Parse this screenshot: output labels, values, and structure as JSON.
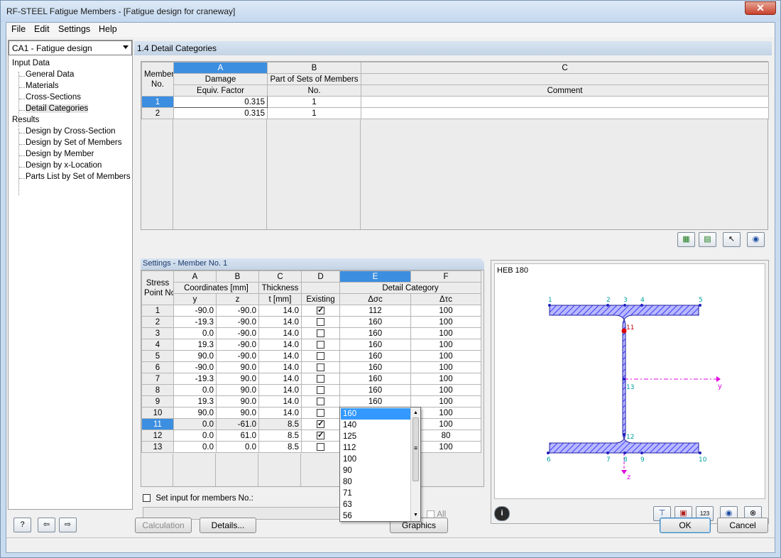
{
  "window": {
    "title": "RF-STEEL Fatigue Members - [Fatigue design for craneway]",
    "close": "✕"
  },
  "menu": {
    "file": "File",
    "edit": "Edit",
    "settings": "Settings",
    "help": "Help"
  },
  "case_combo": {
    "value": "CA1 - Fatigue design"
  },
  "nav": {
    "input_data": "Input Data",
    "general_data": "General Data",
    "materials": "Materials",
    "cross_sections": "Cross-Sections",
    "detail_categories": "Detail Categories",
    "results": "Results",
    "design_by_cross_section": "Design by Cross-Section",
    "design_by_set_of_members": "Design by Set of Members",
    "design_by_member": "Design by Member",
    "design_by_x_location": "Design by x-Location",
    "parts_list": "Parts List by Set of Members"
  },
  "top_panel": {
    "title": "1.4 Detail Categories",
    "col_letters": [
      "A",
      "B",
      "C"
    ],
    "h_member_1": "Member",
    "h_member_2": "No.",
    "h_a1": "Damage",
    "h_a2": "Equiv. Factor",
    "h_b1": "Part of Sets of Members",
    "h_b2": "No.",
    "h_c2": "Comment",
    "rows": [
      {
        "no": "1",
        "factor": "0.315",
        "set": "1",
        "comment": ""
      },
      {
        "no": "2",
        "factor": "0.315",
        "set": "1",
        "comment": ""
      }
    ]
  },
  "settings_panel": {
    "title": "Settings - Member No. 1",
    "col_letters": [
      "A",
      "B",
      "C",
      "D",
      "E",
      "F"
    ],
    "h_stress": "Stress",
    "h_point": "Point No.",
    "h_coords": "Coordinates [mm]",
    "h_y": "y",
    "h_z": "z",
    "h_thick": "Thickness",
    "h_t": "t [mm]",
    "h_existing": "Existing",
    "h_detail": "Detail Category",
    "h_dsigma": "Δσc",
    "h_dtau": "Δτc",
    "rows": [
      {
        "no": "1",
        "y": "-90.0",
        "z": "-90.0",
        "t": "14.0",
        "existing": true,
        "ds": "112",
        "dt": "100"
      },
      {
        "no": "2",
        "y": "-19.3",
        "z": "-90.0",
        "t": "14.0",
        "existing": false,
        "ds": "160",
        "dt": "100"
      },
      {
        "no": "3",
        "y": "0.0",
        "z": "-90.0",
        "t": "14.0",
        "existing": false,
        "ds": "160",
        "dt": "100"
      },
      {
        "no": "4",
        "y": "19.3",
        "z": "-90.0",
        "t": "14.0",
        "existing": false,
        "ds": "160",
        "dt": "100"
      },
      {
        "no": "5",
        "y": "90.0",
        "z": "-90.0",
        "t": "14.0",
        "existing": false,
        "ds": "160",
        "dt": "100"
      },
      {
        "no": "6",
        "y": "-90.0",
        "z": "90.0",
        "t": "14.0",
        "existing": false,
        "ds": "160",
        "dt": "100"
      },
      {
        "no": "7",
        "y": "-19.3",
        "z": "90.0",
        "t": "14.0",
        "existing": false,
        "ds": "160",
        "dt": "100"
      },
      {
        "no": "8",
        "y": "0.0",
        "z": "90.0",
        "t": "14.0",
        "existing": false,
        "ds": "160",
        "dt": "100"
      },
      {
        "no": "9",
        "y": "19.3",
        "z": "90.0",
        "t": "14.0",
        "existing": false,
        "ds": "160",
        "dt": "100"
      },
      {
        "no": "10",
        "y": "90.0",
        "z": "90.0",
        "t": "14.0",
        "existing": false,
        "ds": "160",
        "dt": "100"
      },
      {
        "no": "11",
        "y": "0.0",
        "z": "-61.0",
        "t": "8.5",
        "existing": true,
        "ds": "160",
        "dt": "100"
      },
      {
        "no": "12",
        "y": "0.0",
        "z": "61.0",
        "t": "8.5",
        "existing": true,
        "ds": "",
        "dt": "80"
      },
      {
        "no": "13",
        "y": "0.0",
        "z": "0.0",
        "t": "8.5",
        "existing": false,
        "ds": "",
        "dt": "100"
      }
    ],
    "set_input_label": "Set input for members No.:",
    "all_label": "All"
  },
  "dropdown": {
    "options": [
      "160",
      "140",
      "125",
      "112",
      "100",
      "90",
      "80",
      "71",
      "63",
      "56"
    ],
    "selected": "160"
  },
  "graphic": {
    "section_name": "HEB 180",
    "points": [
      "1",
      "2",
      "3",
      "4",
      "5",
      "6",
      "7",
      "8",
      "9",
      "10",
      "11",
      "12",
      "13"
    ],
    "axis_y": "y",
    "axis_z": "z",
    "colors": {
      "hatch": "#3a3aff",
      "axis": "#e000e0",
      "point_label": "#00a0a0"
    }
  },
  "buttons": {
    "calculation": "Calculation",
    "details": "Details...",
    "graphics": "Graphics",
    "ok": "OK",
    "cancel": "Cancel",
    "info_icon": "i",
    "view_icon_label": "123"
  }
}
